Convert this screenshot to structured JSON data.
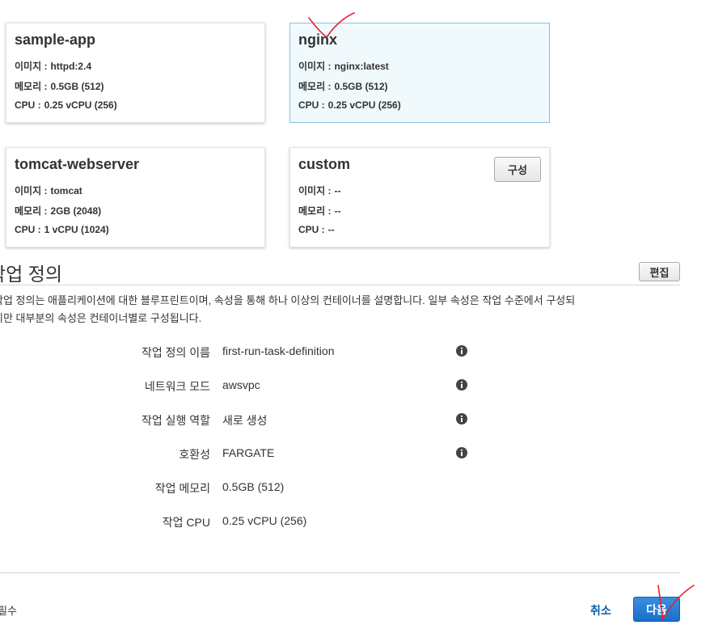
{
  "cards": [
    {
      "title": "sample-app",
      "image_label": "이미지 :",
      "image": "httpd:2.4",
      "memory_label": "메모리 :",
      "memory": "0.5GB (512)",
      "cpu_label": "CPU :",
      "cpu": "0.25 vCPU (256)"
    },
    {
      "title": "nginx",
      "image_label": "이미지 :",
      "image": "nginx:latest",
      "memory_label": "메모리 :",
      "memory": "0.5GB (512)",
      "cpu_label": "CPU :",
      "cpu": "0.25 vCPU (256)"
    },
    {
      "title": "tomcat-webserver",
      "image_label": "이미지 :",
      "image": "tomcat",
      "memory_label": "메모리 :",
      "memory": "2GB (2048)",
      "cpu_label": "CPU :",
      "cpu": "1 vCPU (1024)"
    },
    {
      "title": "custom",
      "image_label": "이미지 :",
      "image": "--",
      "memory_label": "메모리 :",
      "memory": "--",
      "cpu_label": "CPU :",
      "cpu": "--",
      "configure_label": "구성"
    }
  ],
  "task_definition": {
    "title": "작업 정의",
    "edit_label": "편집",
    "description_line1": "작업 정의는 애플리케이션에 대한 블루프린트이며, 속성을 통해 하나 이상의 컨테이너를 설명합니다. 일부 속성은 작업 수준에서 구성되",
    "description_line2": "지만 대부분의 속성은 컨테이너별로 구성됩니다.",
    "fields": [
      {
        "label": "작업 정의 이름",
        "value": "first-run-task-definition"
      },
      {
        "label": "네트워크 모드",
        "value": "awsvpc"
      },
      {
        "label": "작업 실행 역할",
        "value": "새로 생성"
      },
      {
        "label": "호환성",
        "value": "FARGATE"
      },
      {
        "label": "작업 메모리",
        "value": "0.5GB (512)"
      },
      {
        "label": "작업 CPU",
        "value": "0.25 vCPU (256)"
      }
    ]
  },
  "footer": {
    "required_label": "필수",
    "cancel_label": "취소",
    "next_label": "다음"
  },
  "colors": {
    "selected_card_bg": "#f0fafd",
    "primary_button": "#1a6fc9",
    "link": "#0a5fa8",
    "annotation": "#e8202a"
  }
}
